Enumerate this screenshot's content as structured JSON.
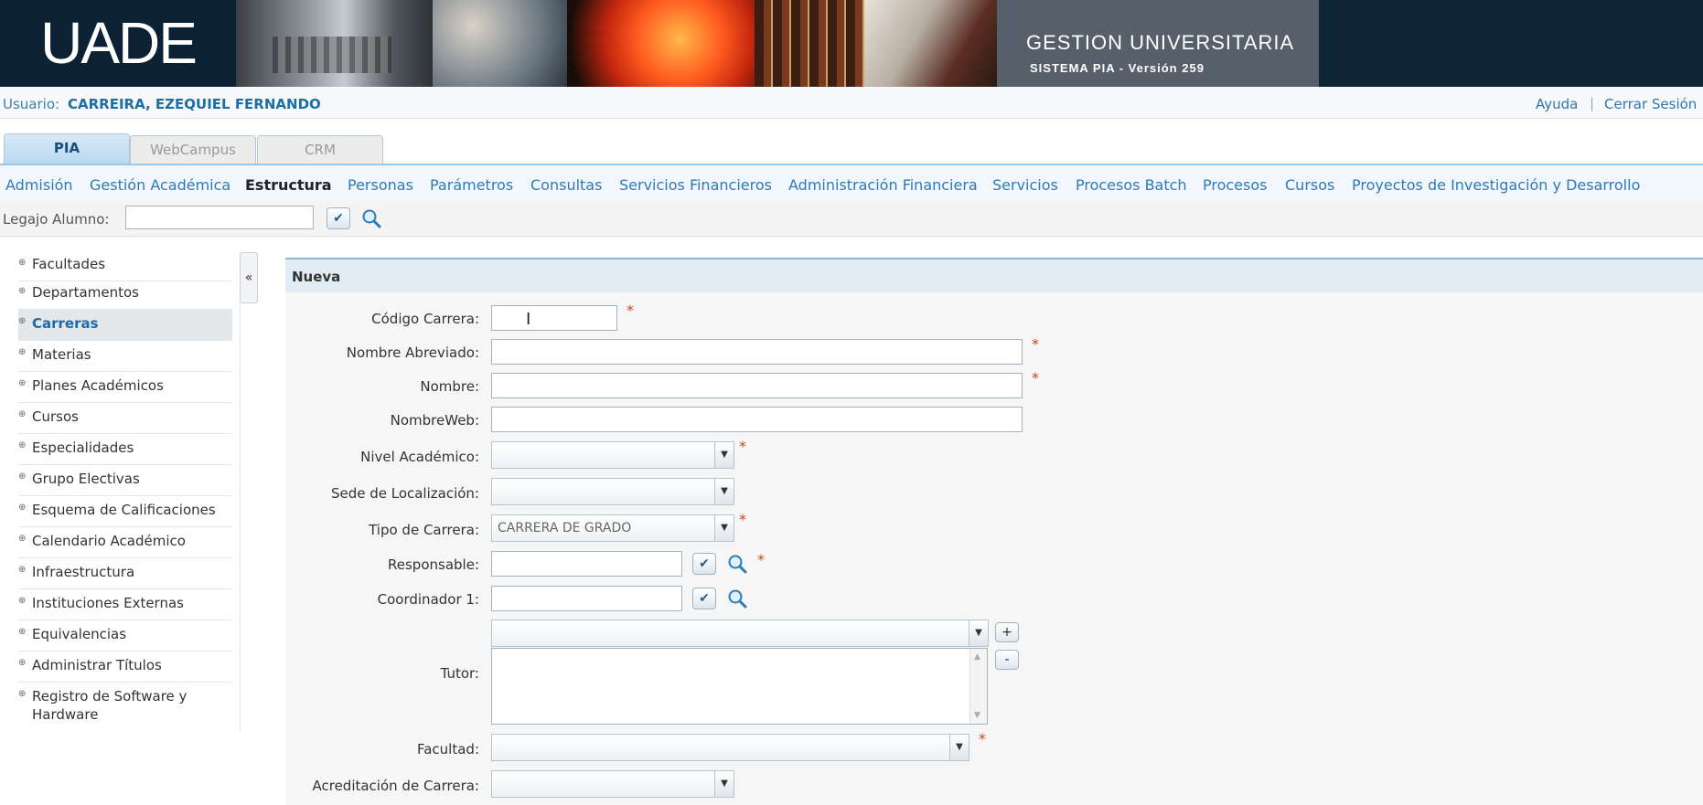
{
  "banner": {
    "logo": "UADE",
    "system_title": "GESTION UNIVERSITARIA",
    "system_version": "SISTEMA PIA - Versión 259"
  },
  "user": {
    "label": "Usuario:",
    "name": "CARREIRA, EZEQUIEL FERNANDO",
    "help": "Ayuda",
    "separator": "|",
    "logout": "Cerrar Sesión"
  },
  "tabs": [
    "PIA",
    "WebCampus",
    "CRM"
  ],
  "menu": [
    "Admisión",
    "Gestión Académica",
    "Estructura",
    "Personas",
    "Parámetros",
    "Consultas",
    "Servicios Financieros",
    "Administración Financiera",
    "Servicios",
    "Procesos Batch",
    "Procesos",
    "Cursos",
    "Proyectos de Investigación y Desarrollo"
  ],
  "legajo": {
    "label": "Legajo Alumno:",
    "value": ""
  },
  "sidebar": {
    "items": [
      "Facultades",
      "Departamentos",
      "Carreras",
      "Materias",
      "Planes Académicos",
      "Cursos",
      "Especialidades",
      "Grupo Electivas",
      "Esquema de Calificaciones",
      "Calendario Académico",
      "Infraestructura",
      "Instituciones Externas",
      "Equivalencias",
      "Administrar Títulos",
      "Registro de Software y Hardware"
    ],
    "active": "Carreras",
    "collapse_icon": "«"
  },
  "form": {
    "title": "Nueva",
    "labels": {
      "codigo": "Código Carrera:",
      "nombre_abreviado": "Nombre Abreviado:",
      "nombre": "Nombre:",
      "nombre_web": "NombreWeb:",
      "nivel": "Nivel Académico:",
      "sede": "Sede de Localización:",
      "tipo": "Tipo de Carrera:",
      "responsable": "Responsable:",
      "coordinador": "Coordinador 1:",
      "tutor": "Tutor:",
      "facultad": "Facultad:",
      "acreditacion": "Acreditación de Carrera:"
    },
    "values": {
      "tipo": "CARRERA DE GRADO"
    },
    "required_mark": "*",
    "add_label": "+",
    "remove_label": "-"
  },
  "icons": {
    "check": "check-icon",
    "search": "search-icon",
    "dropdown": "chevron-down-icon"
  },
  "colors": {
    "accent": "#2e7ab8",
    "banner": "#0e2535",
    "required": "#d1431c"
  }
}
